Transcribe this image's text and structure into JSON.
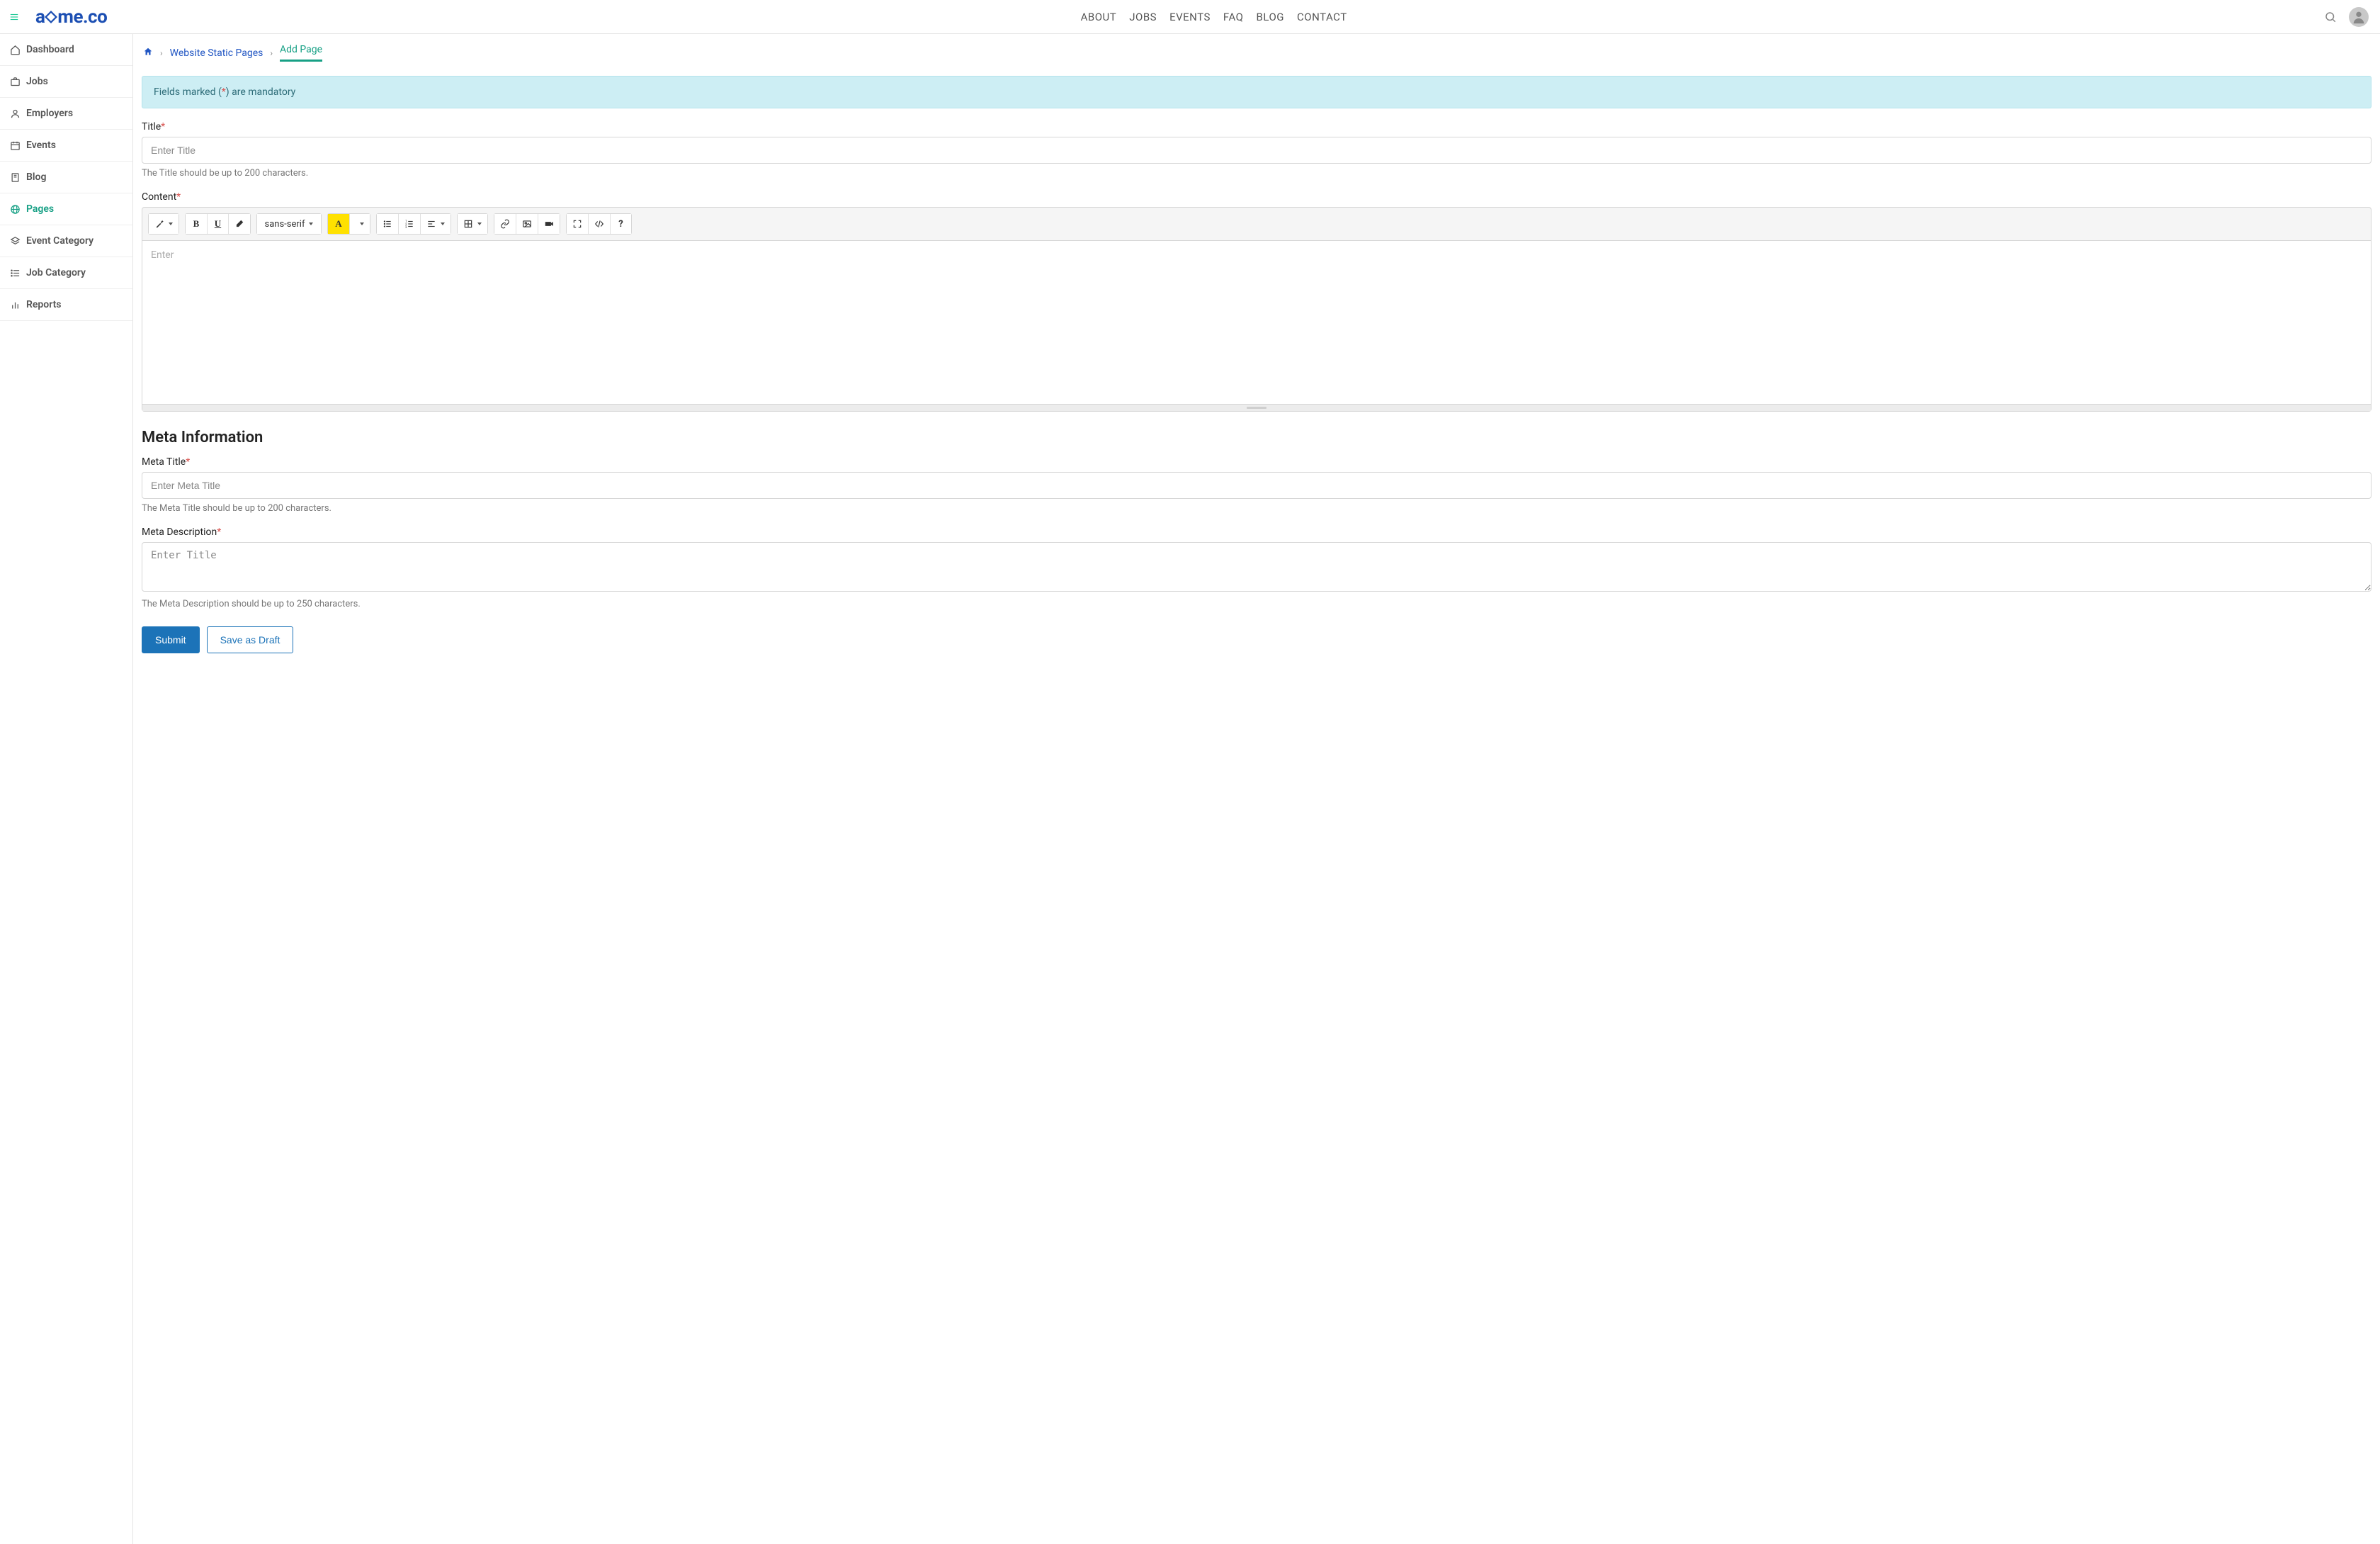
{
  "logo_text_left": "a",
  "logo_text_right": "me.co",
  "nav": [
    "ABOUT",
    "JOBS",
    "EVENTS",
    "FAQ",
    "BLOG",
    "CONTACT"
  ],
  "sidebar": {
    "items": [
      {
        "label": "Dashboard"
      },
      {
        "label": "Jobs"
      },
      {
        "label": "Employers"
      },
      {
        "label": "Events"
      },
      {
        "label": "Blog"
      },
      {
        "label": "Pages"
      },
      {
        "label": "Event Category"
      },
      {
        "label": "Job Category"
      },
      {
        "label": "Reports"
      }
    ]
  },
  "breadcrumb": {
    "link1": "Website Static Pages",
    "current": "Add Page"
  },
  "alert": {
    "before": "Fields marked (",
    "star": "*",
    "after": ") are mandatory"
  },
  "form": {
    "title_label": "Title",
    "title_placeholder": "Enter Title",
    "title_help": "The Title should be up to 200 characters.",
    "content_label": "Content",
    "editor_font": "sans-serif",
    "editor_placeholder": "Enter",
    "meta_heading": "Meta Information",
    "meta_title_label": "Meta Title",
    "meta_title_placeholder": "Enter Meta Title",
    "meta_title_help": "The Meta Title should be up to 200 characters.",
    "meta_desc_label": "Meta Description",
    "meta_desc_placeholder": "Enter Title",
    "meta_desc_help": "The Meta Description should be up to 250 characters.",
    "submit": "Submit",
    "draft": "Save as Draft"
  }
}
